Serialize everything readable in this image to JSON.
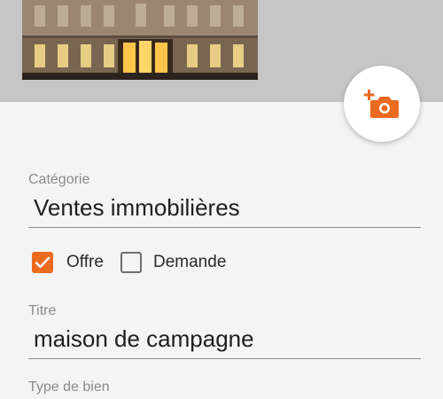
{
  "photo": {
    "icon": "building-photo",
    "add_button_icon": "add-photo-camera-icon",
    "accent_color": "#ea6a1f"
  },
  "category": {
    "label": "Catégorie",
    "value": "Ventes immobilières"
  },
  "type_options": [
    {
      "label": "Offre",
      "checked": true
    },
    {
      "label": "Demande",
      "checked": false
    }
  ],
  "title_field": {
    "label": "Titre",
    "value": "maison de campagne"
  },
  "property_type": {
    "label": "Type de bien"
  }
}
